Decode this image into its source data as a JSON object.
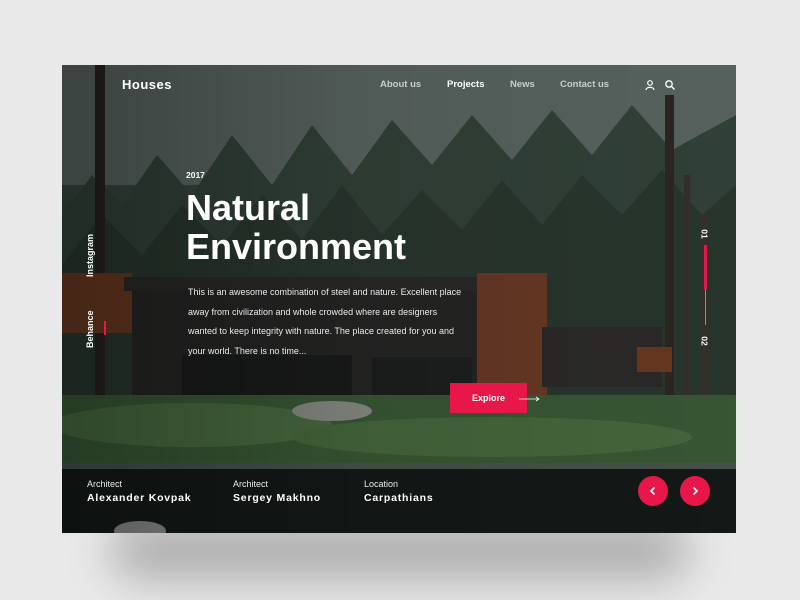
{
  "header": {
    "logo": "Houses",
    "nav": [
      {
        "label": "About us",
        "active": false
      },
      {
        "label": "Projects",
        "active": true
      },
      {
        "label": "News",
        "active": false
      },
      {
        "label": "Contact us",
        "active": false
      }
    ],
    "icons": [
      "user-icon",
      "search-icon"
    ]
  },
  "hero": {
    "year": "2017",
    "title_line1": "Natural",
    "title_line2": "Environment",
    "description": "This is an awesome combination of steel and nature. Excellent place away from civilization and whole crowded where are designers wanted to keep integrity with nature. The place created for you and your world. There is no time...",
    "cta_label": "Explore"
  },
  "social": {
    "instagram": "Instagram",
    "behance": "Behance"
  },
  "slider": {
    "current": "01",
    "total": "02",
    "progress": 0.55
  },
  "details": [
    {
      "label": "Architect",
      "value": "Alexander Kovpak"
    },
    {
      "label": "Architect",
      "value": "Sergey Makhno"
    },
    {
      "label": "Location",
      "value": "Carpathians"
    }
  ],
  "controls": {
    "prev_icon": "chevron-left-icon",
    "next_icon": "chevron-right-icon"
  },
  "colors": {
    "accent": "#e8174a",
    "text": "#ffffff"
  }
}
